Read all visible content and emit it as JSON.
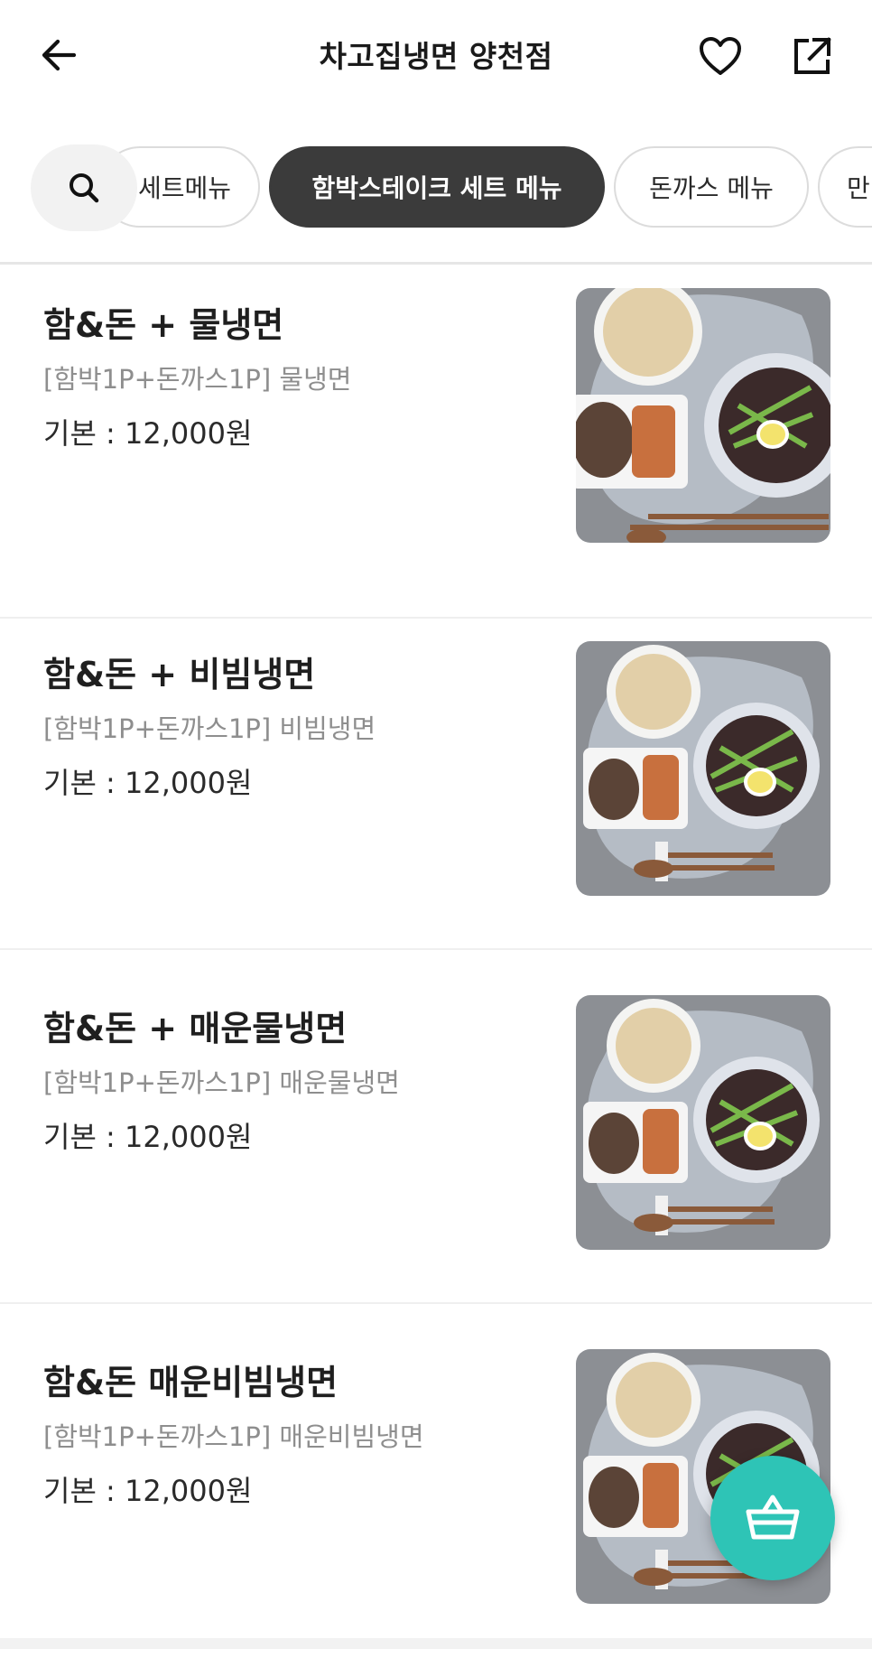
{
  "header": {
    "title": "차고집냉면 양천점",
    "back_icon": "arrow-left-icon",
    "favorite_icon": "heart-outline-icon",
    "share_icon": "share-external-icon"
  },
  "categories": {
    "search_icon": "search-icon",
    "chips": [
      {
        "label": "세트메뉴",
        "visible_text": "세트메뉴",
        "active": false
      },
      {
        "label": "함박스테이크 세트 메뉴",
        "active": true
      },
      {
        "label": "돈까스 메뉴",
        "active": false
      },
      {
        "label": "만",
        "active": false
      }
    ]
  },
  "menu_items": [
    {
      "name": "함&돈 + 물냉면",
      "desc": "[함박1P+돈까스1P] 물냉면",
      "price": "기본 : 12,000원"
    },
    {
      "name": "함&돈 + 비빔냉면",
      "desc": "[함박1P+돈까스1P] 비빔냉면",
      "price": "기본 : 12,000원"
    },
    {
      "name": "함&돈 + 매운물냉면",
      "desc": "[함박1P+돈까스1P] 매운물냉면",
      "price": "기본 : 12,000원"
    },
    {
      "name": "함&돈 매운비빔냉면",
      "desc": "[함박1P+돈까스1P] 매운비빔냉면",
      "price": "기본 : 12,000원"
    }
  ],
  "cart": {
    "icon": "shopping-basket-icon"
  },
  "colors": {
    "accent": "#2ec4b6",
    "chip_active_bg": "#3b3b3b",
    "desc_text": "#8e8e8e"
  }
}
